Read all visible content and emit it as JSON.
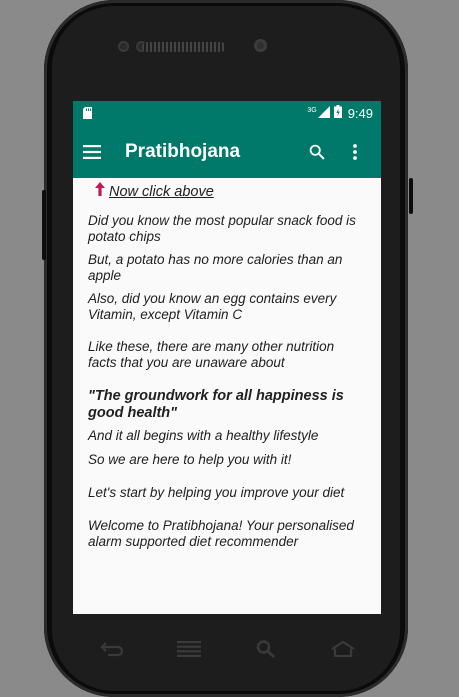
{
  "status_bar": {
    "network": "3G",
    "time": "9:49"
  },
  "app_bar": {
    "title": "Pratibhojana",
    "icons": [
      "menu-icon",
      "search-icon",
      "overflow-menu-icon"
    ]
  },
  "content": {
    "hint": "Now click above",
    "paragraphs": [
      "Did you know the most popular snack food is potato chips",
      "But, a potato has no more calories than an apple",
      "Also, did you know an egg contains every Vitamin, except Vitamin C",
      "Like these, there are many other nutrition facts that you are unaware about",
      "\"The groundwork for all happiness is good health\"",
      "And it all begins with a healthy lifestyle",
      "So we are here to help you with it!",
      "Let's start by helping you improve your diet",
      "Welcome to Pratibhojana! Your personalised alarm supported diet recommender"
    ]
  },
  "nav": [
    "back-icon",
    "menu-icon",
    "search-icon",
    "home-icon"
  ],
  "colors": {
    "primary": "#00796b",
    "arrow": "#c2185b",
    "background": "#fafafa"
  }
}
